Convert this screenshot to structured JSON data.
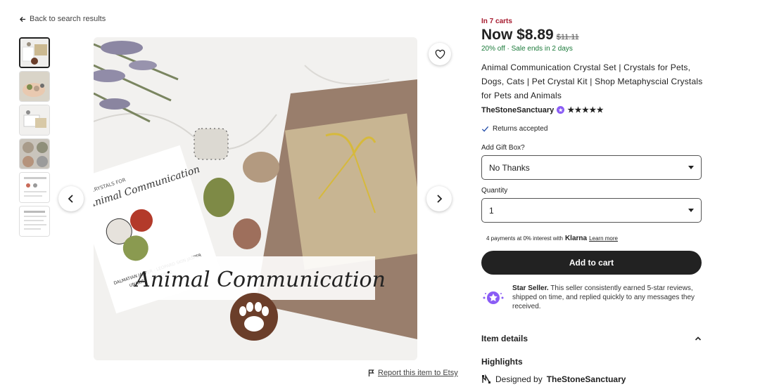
{
  "nav": {
    "back_label": "Back to search results",
    "report_label": "Report this item to Etsy"
  },
  "gallery": {
    "thumbnail_count": 6,
    "selected_index": 0,
    "image_text": {
      "banner_title": "Animal Communication",
      "card_header": "CRYSTALS FOR",
      "card_title": "Animal Communication",
      "card_stones": "DALMATIAN JASPER · LEOPARD SKIN JASPER",
      "card_stones2": "UNAKITE · MOOKAITE"
    }
  },
  "product": {
    "in_carts": "In 7 carts",
    "price_now": "Now $8.89",
    "price_old": "$11.11",
    "discount": "20% off · Sale ends in 2 days",
    "title": "Animal Communication Crystal Set | Crystals for Pets, Dogs, Cats | Pet Crystal Kit | Shop Metaphyscial Crystals for Pets and Animals",
    "shop_name": "TheStoneSanctuary",
    "stars": "★★★★★",
    "returns": "Returns accepted"
  },
  "options": {
    "gift_box_label": "Add Gift Box?",
    "gift_box_value": "No Thanks",
    "quantity_label": "Quantity",
    "quantity_value": "1"
  },
  "payments": {
    "prefix": "4 payments at 0% interest with",
    "provider": "Klarna",
    "learn_more": "Learn more"
  },
  "cart": {
    "add_label": "Add to cart"
  },
  "star_seller": {
    "title": "Star Seller.",
    "text": " This seller consistently earned 5-star reviews, shipped on time, and replied quickly to any messages they received."
  },
  "details": {
    "item_details_label": "Item details",
    "highlights_label": "Highlights",
    "designed_by_prefix": "Designed by",
    "designed_by_shop": "TheStoneSanctuary"
  },
  "colors": {
    "accent_dark": "#222222",
    "carts_red": "#a61a2e",
    "sale_green": "#1b7a3a",
    "star_seller_purple": "#8a5cf5"
  }
}
